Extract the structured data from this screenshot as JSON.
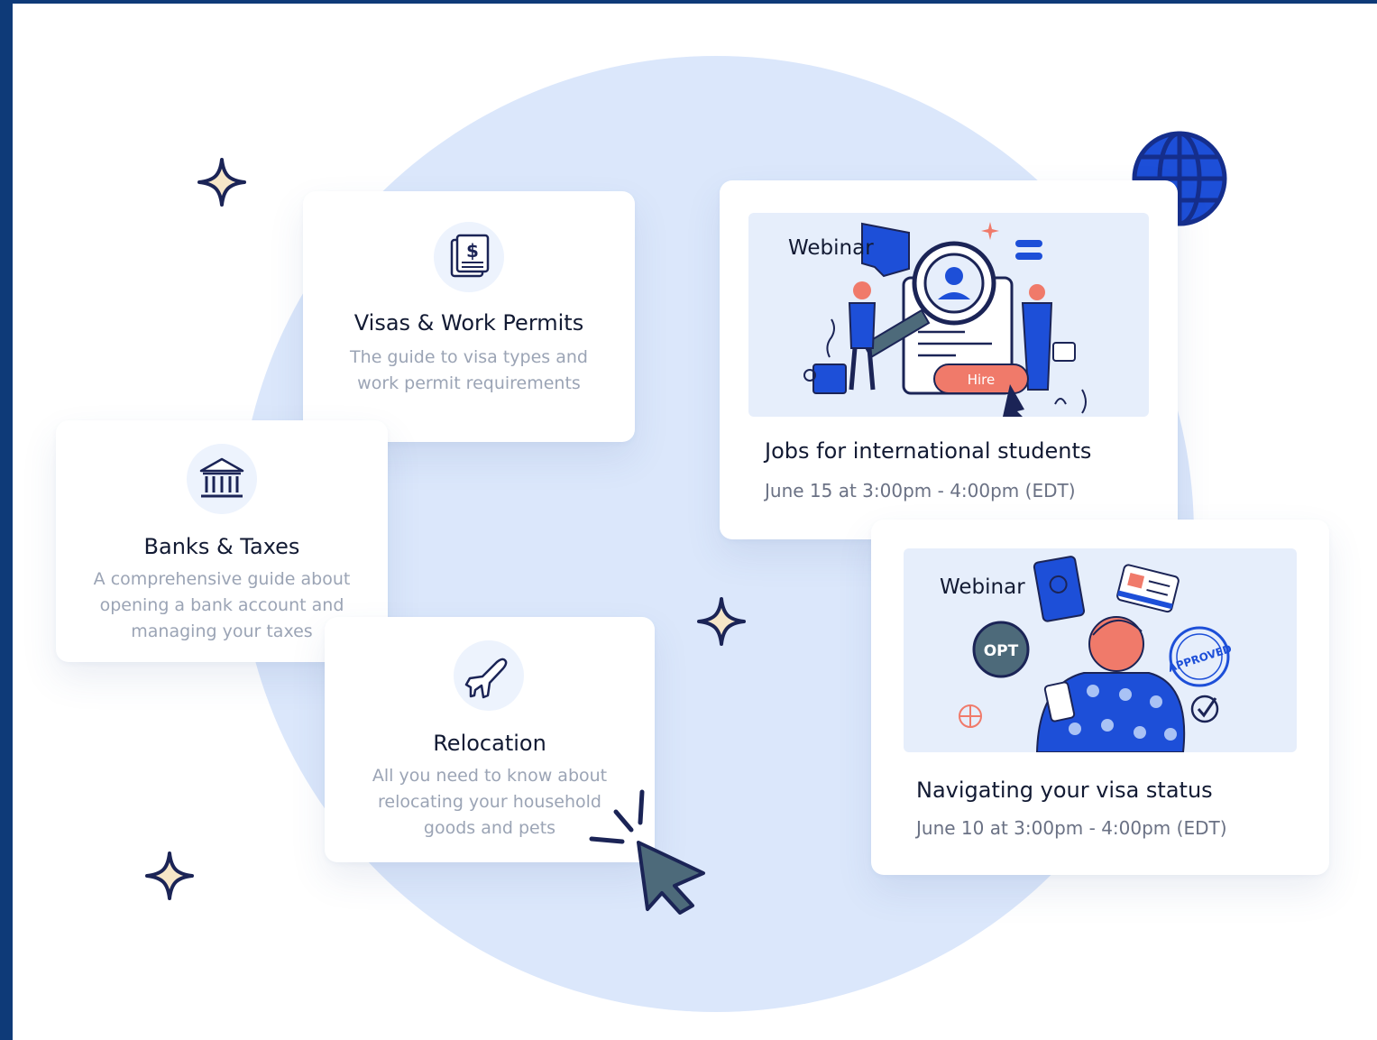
{
  "cards": {
    "visas": {
      "title": "Visas & Work Permits",
      "description": "The guide to visa types and\nwork permit requirements",
      "icon": "dollar-document-icon"
    },
    "banks": {
      "title": "Banks & Taxes",
      "description": "A comprehensive guide about\nopening a bank account and\nmanaging your taxes",
      "icon": "bank-icon"
    },
    "relocation": {
      "title": "Relocation",
      "description": "All you need to know about\nrelocating your household\ngoods and pets",
      "icon": "airplane-icon"
    }
  },
  "webinars": [
    {
      "label": "Webinar",
      "title": "Jobs for international students",
      "date": "June 15 at 3:00pm - 4:00pm (EDT)",
      "badge": "Hire"
    },
    {
      "label": "Webinar",
      "title": "Navigating your visa status",
      "date": "June 10 at 3:00pm - 4:00pm (EDT)",
      "badges": [
        "OPT",
        "APPROVED"
      ]
    }
  ],
  "colors": {
    "background_circle": "#dbe7fb",
    "brand_blue": "#1d4fd8",
    "navy": "#1b2456",
    "sparkle_fill": "#f6e6c8",
    "hire_button": "#f07a6a"
  }
}
